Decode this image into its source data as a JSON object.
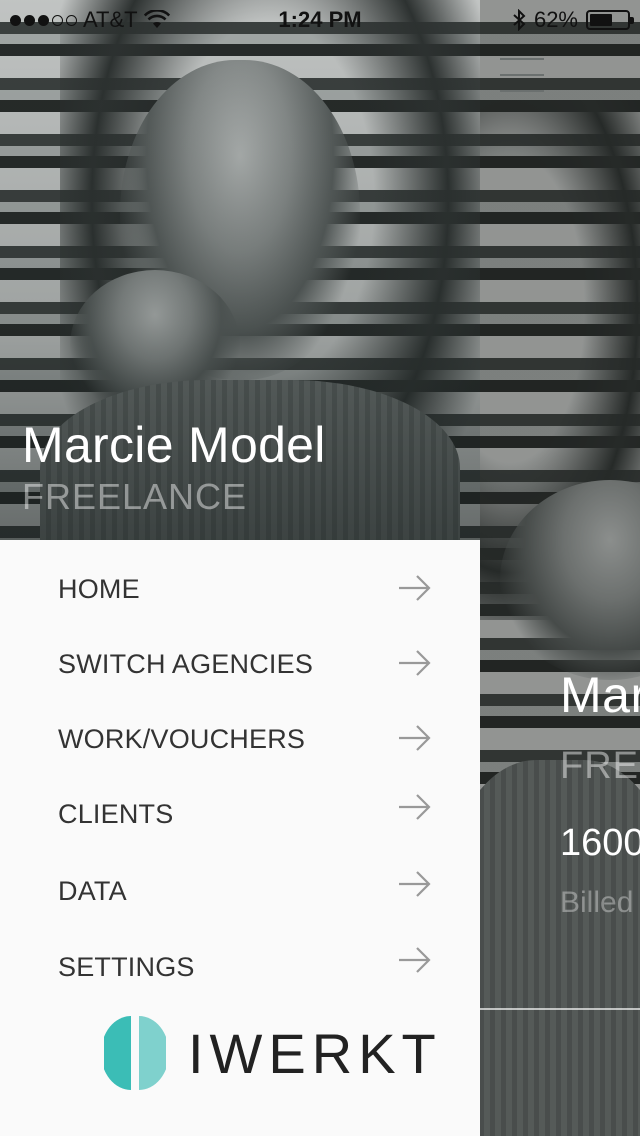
{
  "status_bar": {
    "carrier": "AT&T",
    "time": "1:24 PM",
    "battery_percent": "62%",
    "battery_level": 0.62,
    "signal_dots_filled": 3,
    "signal_dots_total": 5
  },
  "drawer": {
    "profile": {
      "name": "Marcie Model",
      "role": "FREELANCE"
    },
    "menu": [
      {
        "label": "HOME"
      },
      {
        "label": "SWITCH AGENCIES"
      },
      {
        "label": "WORK/VOUCHERS"
      },
      {
        "label": "CLIENTS"
      },
      {
        "label": "DATA"
      },
      {
        "label": "SETTINGS"
      }
    ],
    "logo_text": "IWERKT"
  },
  "main": {
    "name_partial": "Mar",
    "role_partial": "FREE",
    "amount_partial": "1600",
    "billed_partial": "Billed"
  },
  "colors": {
    "logo_teal_light": "#7fd1cd",
    "logo_teal_dark": "#3bbdb6",
    "menu_bg": "#fafafa",
    "menu_text": "#333333",
    "arrow": "#999999"
  },
  "icons": {
    "menu_arrow": "arrow-right-icon",
    "hamburger": "hamburger-menu-icon",
    "wifi": "wifi-icon",
    "bluetooth": "bluetooth-icon",
    "battery": "battery-icon"
  }
}
